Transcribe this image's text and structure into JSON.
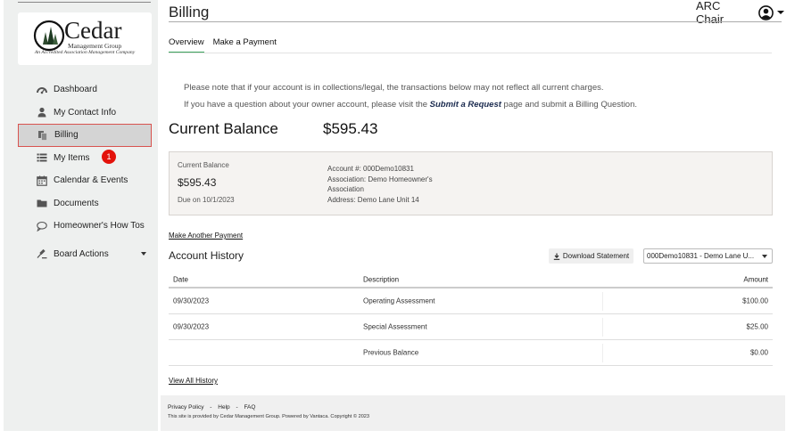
{
  "logo": {
    "name": "Cedar",
    "subtitle": "Management Group",
    "tagline": "An Accredited Association Management Company"
  },
  "sidebar": {
    "items": [
      {
        "label": "Dashboard",
        "icon": "dashboard-icon"
      },
      {
        "label": "My Contact Info",
        "icon": "person-icon"
      },
      {
        "label": "Billing",
        "icon": "billing-icon",
        "active": true
      },
      {
        "label": "My Items",
        "icon": "list-icon",
        "badge": "1"
      },
      {
        "label": "Calendar & Events",
        "icon": "calendar-icon"
      },
      {
        "label": "Documents",
        "icon": "folder-icon"
      },
      {
        "label": "Homeowner's How Tos",
        "icon": "chat-icon"
      },
      {
        "label": "Board Actions",
        "icon": "gavel-icon",
        "has_dropdown": true
      }
    ]
  },
  "header": {
    "title": "Billing",
    "user_name": "ARC Chair"
  },
  "tabs": [
    {
      "label": "Overview",
      "active": true
    },
    {
      "label": "Make a Payment",
      "active": false
    }
  ],
  "notices": {
    "collections": "Please note that if your account is in collections/legal, the transactions below may not reflect all current charges.",
    "question_prefix": "If you have a question about your owner account, please visit the ",
    "question_link": "Submit a Request",
    "question_suffix": " page and submit a Billing Question."
  },
  "balance": {
    "heading": "Current Balance",
    "amount": "$595.43"
  },
  "summary": {
    "label": "Current Balance",
    "amount": "$595.43",
    "due": "Due on 10/1/2023",
    "account": "Account #: 000Demo10831",
    "association": "Association: Demo Homeowner's Association",
    "address": "Address: Demo Lane Unit 14"
  },
  "make_another_payment": "Make Another Payment",
  "history": {
    "title": "Account History",
    "download_label": "Download Statement",
    "account_select": "000Demo10831 - Demo Lane U...",
    "columns": {
      "date": "Date",
      "description": "Description",
      "amount": "Amount"
    },
    "rows": [
      {
        "date": "09/30/2023",
        "description": "Operating Assessment",
        "amount": "$100.00"
      },
      {
        "date": "09/30/2023",
        "description": "Special Assessment",
        "amount": "$25.00"
      },
      {
        "date": "",
        "description": "Previous Balance",
        "amount": "$0.00"
      }
    ],
    "view_all": "View All History"
  },
  "footer": {
    "privacy": "Privacy Policy",
    "sep": "-",
    "help": "Help",
    "faq": "FAQ",
    "copyright": "This site is provided by Cedar Management Group. Powered by Vantaca. Copyright © 2023"
  },
  "colors": {
    "active_tab_underline": "#3da35d",
    "badge": "#e3120b",
    "active_nav_border": "#d9534f",
    "link": "#1a2a4e"
  }
}
